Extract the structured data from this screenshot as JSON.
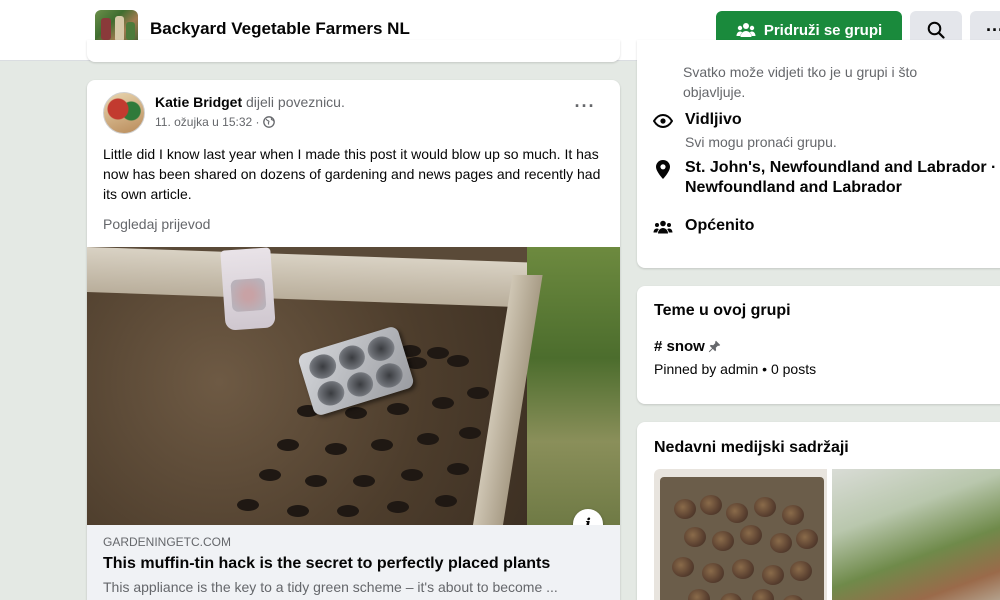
{
  "header": {
    "group_name": "Backyard Vegetable Farmers NL",
    "join_label": "Pridruži se grupi",
    "more_label": "···"
  },
  "post": {
    "author": "Katie Bridget",
    "action": "dijeli poveznicu.",
    "timestamp": "11. ožujka u 15:32 ·",
    "more_label": "···",
    "text": "Little did I know last year when I made this post it would blow up so much. It has now has been shared on dozens of gardening and news pages and recently had its own article.",
    "translate_label": "Pogledaj prijevod",
    "link": {
      "domain": "GARDENINGETC.COM",
      "title": "This muffin-tin hack is the secret to perfectly placed plants",
      "description": "This appliance is the key to a tidy green scheme – it's about to become ..."
    },
    "info_label": "i"
  },
  "about": {
    "privacy_desc_line1": "Svatko može vidjeti tko je u grupi i što",
    "privacy_desc_line2": "objavljuje.",
    "visible_title": "Vidljivo",
    "visible_desc": "Svi mogu pronaći grupu.",
    "location_line1": "St. John's, Newfoundland and Labrador ·",
    "location_line2": "Newfoundland and Labrador",
    "category": "Općenito"
  },
  "topics": {
    "heading": "Teme u ovoj grupi",
    "tag": "# snow",
    "meta": "Pinned by admin • 0 posts"
  },
  "media": {
    "heading": "Nedavni medijski sadržaji"
  },
  "colors": {
    "join_button": "#1a8a3c",
    "page_background": "#e4e9e4",
    "secondary_text": "#65676b"
  }
}
